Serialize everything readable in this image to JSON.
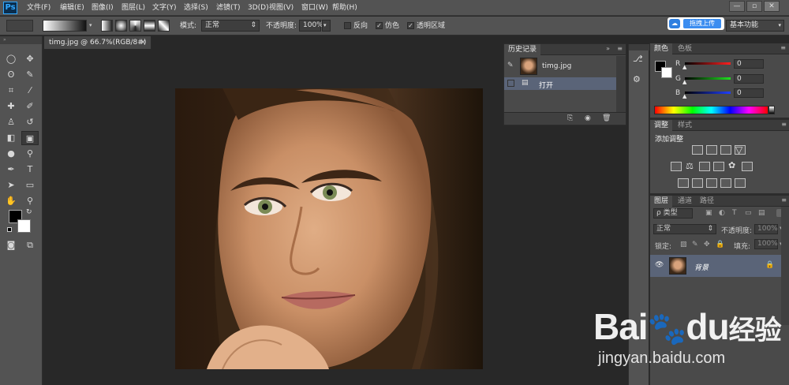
{
  "app": {
    "logo": "Ps"
  },
  "menu": [
    "文件(F)",
    "编辑(E)",
    "图像(I)",
    "图层(L)",
    "文字(Y)",
    "选择(S)",
    "滤镜(T)",
    "3D(D)",
    "视图(V)",
    "窗口(W)",
    "帮助(H)"
  ],
  "window_controls": {
    "minimize": "—",
    "maximize": "▫",
    "close": "✕"
  },
  "options": {
    "mode_label": "模式:",
    "mode_value": "正常",
    "opacity_label": "不透明度:",
    "opacity_value": "100%",
    "reverse_label": "反向",
    "dither_label": "仿色",
    "transparency_label": "透明区域",
    "workspace": "基本功能"
  },
  "baidu_upload": {
    "label": "拖拽上传"
  },
  "document": {
    "tab_title": "timg.jpg @ 66.7%(RGB/8#)",
    "close": "×"
  },
  "history": {
    "tab_label": "历史记录",
    "snapshot_name": "timg.jpg",
    "steps": [
      {
        "label": "打开"
      }
    ]
  },
  "color_panel": {
    "tabs": [
      "颜色",
      "色板"
    ],
    "channels": [
      {
        "label": "R",
        "value": "0",
        "color": "#ff2020"
      },
      {
        "label": "G",
        "value": "0",
        "color": "#20e020"
      },
      {
        "label": "B",
        "value": "0",
        "color": "#2040ff"
      }
    ]
  },
  "adjustments": {
    "tabs": [
      "调整",
      "样式"
    ],
    "heading": "添加调整"
  },
  "layers": {
    "tabs": [
      "图层",
      "通道",
      "路径"
    ],
    "filter_label": "ρ 类型",
    "blend_mode": "正常",
    "opacity_label": "不透明度:",
    "opacity_value": "100%",
    "lock_label": "锁定:",
    "fill_label": "填充:",
    "fill_value": "100%",
    "items": [
      {
        "name": "背景"
      }
    ]
  },
  "watermark": {
    "brand": "Bai",
    "brand_suffix": "du",
    "brand_cn": "经验",
    "url": "jingyan.baidu.com"
  },
  "colors": {
    "accent": "#31a8ff",
    "selected_row": "#5a6478",
    "baidu_blue": "#2e7fe0"
  }
}
